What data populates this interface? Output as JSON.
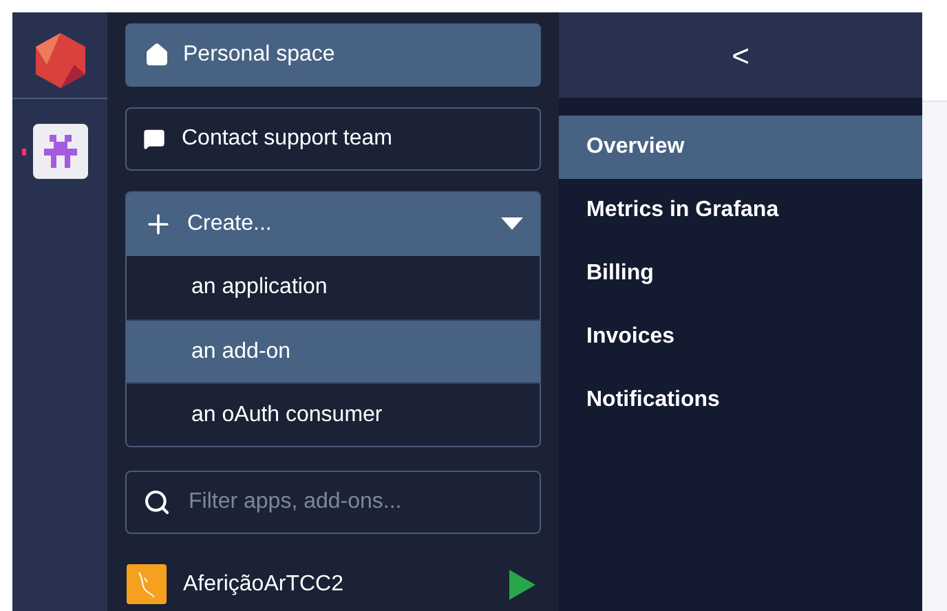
{
  "rail": {
    "items": [
      {
        "kind": "logo",
        "selected": false
      },
      {
        "kind": "org",
        "selected": true
      }
    ]
  },
  "panel": {
    "personal_space": "Personal space",
    "contact_support": "Contact support team",
    "create": {
      "label": "Create...",
      "expanded": true,
      "options": [
        {
          "label": "an application",
          "selected": false
        },
        {
          "label": "an add-on",
          "selected": true
        },
        {
          "label": "an oAuth consumer",
          "selected": false
        }
      ]
    },
    "filter": {
      "placeholder": "Filter apps, add-ons..."
    },
    "apps": [
      {
        "name": "AferiçãoArTCC2",
        "running": true
      }
    ]
  },
  "nav": {
    "back": "<",
    "items": [
      {
        "label": "Overview",
        "selected": true
      },
      {
        "label": "Metrics in Grafana",
        "selected": false
      },
      {
        "label": "Billing",
        "selected": false
      },
      {
        "label": "Invoices",
        "selected": false
      },
      {
        "label": "Notifications",
        "selected": false
      }
    ]
  }
}
